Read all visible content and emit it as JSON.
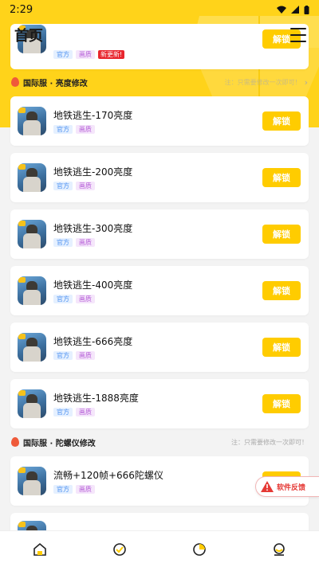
{
  "status": {
    "time": "2:29"
  },
  "header": {
    "title": "首页",
    "menu_icon": "hamburger-menu-icon"
  },
  "top_partial_card": {
    "badges": [
      "官方",
      "画质",
      "新更新!"
    ],
    "button": "解锁"
  },
  "section1": {
    "title": "国际服 · 亮度修改",
    "note": "注：只需要修改一次即可！"
  },
  "items": [
    {
      "title": "地铁逃生-170亮度",
      "badges": [
        "官方",
        "画质"
      ],
      "button": "解锁"
    },
    {
      "title": "地铁逃生-200亮度",
      "badges": [
        "官方",
        "画质"
      ],
      "button": "解锁"
    },
    {
      "title": "地铁逃生-300亮度",
      "badges": [
        "官方",
        "画质"
      ],
      "button": "解锁"
    },
    {
      "title": "地铁逃生-400亮度",
      "badges": [
        "官方",
        "画质"
      ],
      "button": "解锁"
    },
    {
      "title": "地铁逃生-666亮度",
      "badges": [
        "官方",
        "画质"
      ],
      "button": "解锁"
    },
    {
      "title": "地铁逃生-1888亮度",
      "badges": [
        "官方",
        "画质"
      ],
      "button": "解锁"
    }
  ],
  "section2": {
    "title": "国际服 · 陀螺仪修改",
    "note": "注：只需要修改一次即可！"
  },
  "gyro_item": {
    "title": "流畅+120帧+666陀螺仪",
    "badges": [
      "官方",
      "画质"
    ],
    "button": "解锁"
  },
  "feedback": {
    "label": "软件反馈",
    "icon": "warning-icon"
  },
  "tabbar": {
    "tabs": [
      "home-icon",
      "verified-icon",
      "stats-icon",
      "profile-icon"
    ]
  },
  "colors": {
    "accent": "#ffcc00",
    "hero": "#ffd31a",
    "badge_new": "#e8262e"
  }
}
